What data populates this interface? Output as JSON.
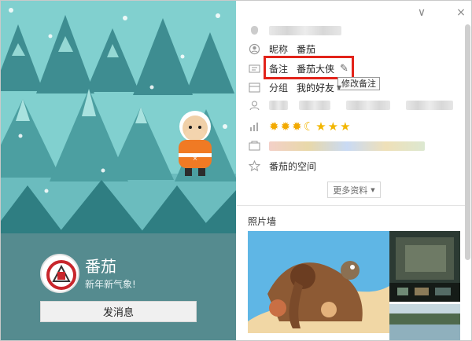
{
  "window": {
    "title_controls": {
      "minimize": "∨",
      "close": "×"
    }
  },
  "left_panel": {
    "display_name": "番茄",
    "signature": "新年新气象!",
    "send_message_label": "发消息"
  },
  "right_panel": {
    "nickname_label": "昵称",
    "nickname_value": "番茄",
    "remark_label": "备注",
    "remark_value": "番茄大侠",
    "remark_tooltip": "修改备注",
    "group_label": "分组",
    "group_value": "我的好友",
    "space_text": "番茄的空间",
    "more_label": "更多资料",
    "photo_wall_label": "照片墙",
    "level_badges": [
      "sun",
      "sun",
      "sun",
      "moon",
      "star",
      "star",
      "star"
    ]
  },
  "colors": {
    "accent_red": "#e2231a",
    "scene_teal": "#7ac7c8",
    "panel_bg": "#558b8f"
  }
}
